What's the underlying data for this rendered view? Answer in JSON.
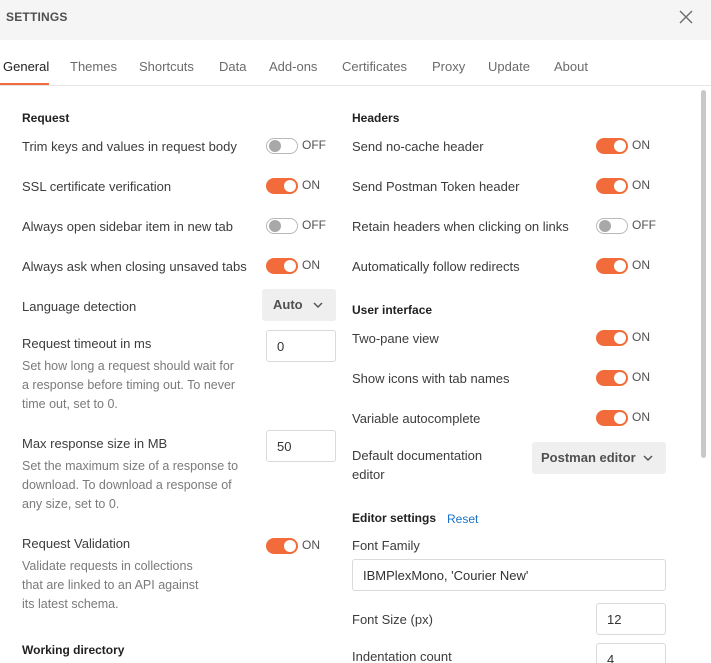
{
  "header": {
    "title": "SETTINGS",
    "close_icon": "close-icon"
  },
  "tabs": [
    "General",
    "Themes",
    "Shortcuts",
    "Data",
    "Add-ons",
    "Certificates",
    "Proxy",
    "Update",
    "About"
  ],
  "active_tab": "General",
  "colors": {
    "accent": "#f26b3a",
    "link": "#1a73c8"
  },
  "request": {
    "title": "Request",
    "trim_keys": {
      "label": "Trim keys and values in request body",
      "state": "OFF"
    },
    "ssl": {
      "label": "SSL certificate verification",
      "state": "ON"
    },
    "sidebar_new_tab": {
      "label": "Always open sidebar item in new tab",
      "state": "OFF"
    },
    "ask_closing": {
      "label": "Always ask when closing unsaved tabs",
      "state": "ON"
    },
    "language": {
      "label": "Language detection",
      "value": "Auto"
    },
    "timeout": {
      "label": "Request timeout in ms",
      "value": "0",
      "help": [
        "Set how long a request should wait for",
        "a response before timing out. To never",
        "time out, set to 0."
      ]
    },
    "max_size": {
      "label": "Max response size in MB",
      "value": "50",
      "help": [
        "Set the maximum size of a response to",
        "download. To download a response of",
        "any size, set to 0."
      ]
    },
    "validation": {
      "label": "Request Validation",
      "state": "ON",
      "help": [
        "Validate requests in collections",
        "that are linked to an API against",
        "its latest schema."
      ]
    }
  },
  "working_directory": {
    "title": "Working directory"
  },
  "headers": {
    "title": "Headers",
    "no_cache": {
      "label": "Send no-cache header",
      "state": "ON"
    },
    "postman_token": {
      "label": "Send Postman Token header",
      "state": "ON"
    },
    "retain": {
      "label": "Retain headers when clicking on links",
      "state": "OFF"
    },
    "follow": {
      "label": "Automatically follow redirects",
      "state": "ON"
    }
  },
  "ui": {
    "title": "User interface",
    "two_pane": {
      "label": "Two-pane view",
      "state": "ON"
    },
    "tab_icons": {
      "label": "Show icons with tab names",
      "state": "ON"
    },
    "autocomplete": {
      "label": "Variable autocomplete",
      "state": "ON"
    },
    "doc_editor": {
      "label_line1": "Default documentation",
      "label_line2": "editor",
      "value": "Postman editor"
    }
  },
  "editor": {
    "title": "Editor settings",
    "reset": "Reset",
    "font_family": {
      "label": "Font Family",
      "value": "IBMPlexMono, 'Courier New'"
    },
    "font_size": {
      "label": "Font Size (px)",
      "value": "12"
    },
    "indentation": {
      "label": "Indentation count",
      "value": "4"
    }
  }
}
